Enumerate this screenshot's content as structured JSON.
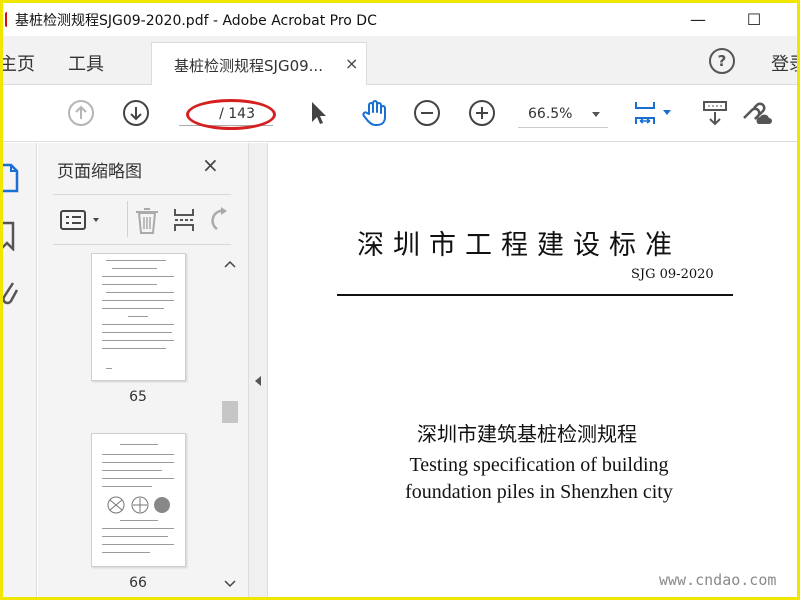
{
  "window": {
    "title": "基桩检测规程SJG09-2020.pdf - Adobe Acrobat Pro DC",
    "minimize": "—",
    "maximize": "☐"
  },
  "tabs": {
    "home": "主页",
    "tools": "工具",
    "document": "基桩检测规程SJG09...",
    "close": "×",
    "help": "?",
    "signin": "登录"
  },
  "toolbar": {
    "page_total": "/ 143",
    "zoom": "66.5%"
  },
  "panel": {
    "title": "页面缩略图",
    "close": "×",
    "thumbnails": [
      {
        "page": "65"
      },
      {
        "page": "66"
      }
    ]
  },
  "document": {
    "standard_title": "深圳市工程建设标准",
    "standard_code": "SJG 09-2020",
    "title_cn": "深圳市建筑基桩检测规程",
    "title_en_line1": "Testing specification of building",
    "title_en_line2": "foundation piles in Shenzhen city"
  },
  "watermark": "www.cndao.com",
  "colors": {
    "frame": "#f1e600",
    "accent": "#1a6fd3",
    "highlight": "#d62020"
  }
}
